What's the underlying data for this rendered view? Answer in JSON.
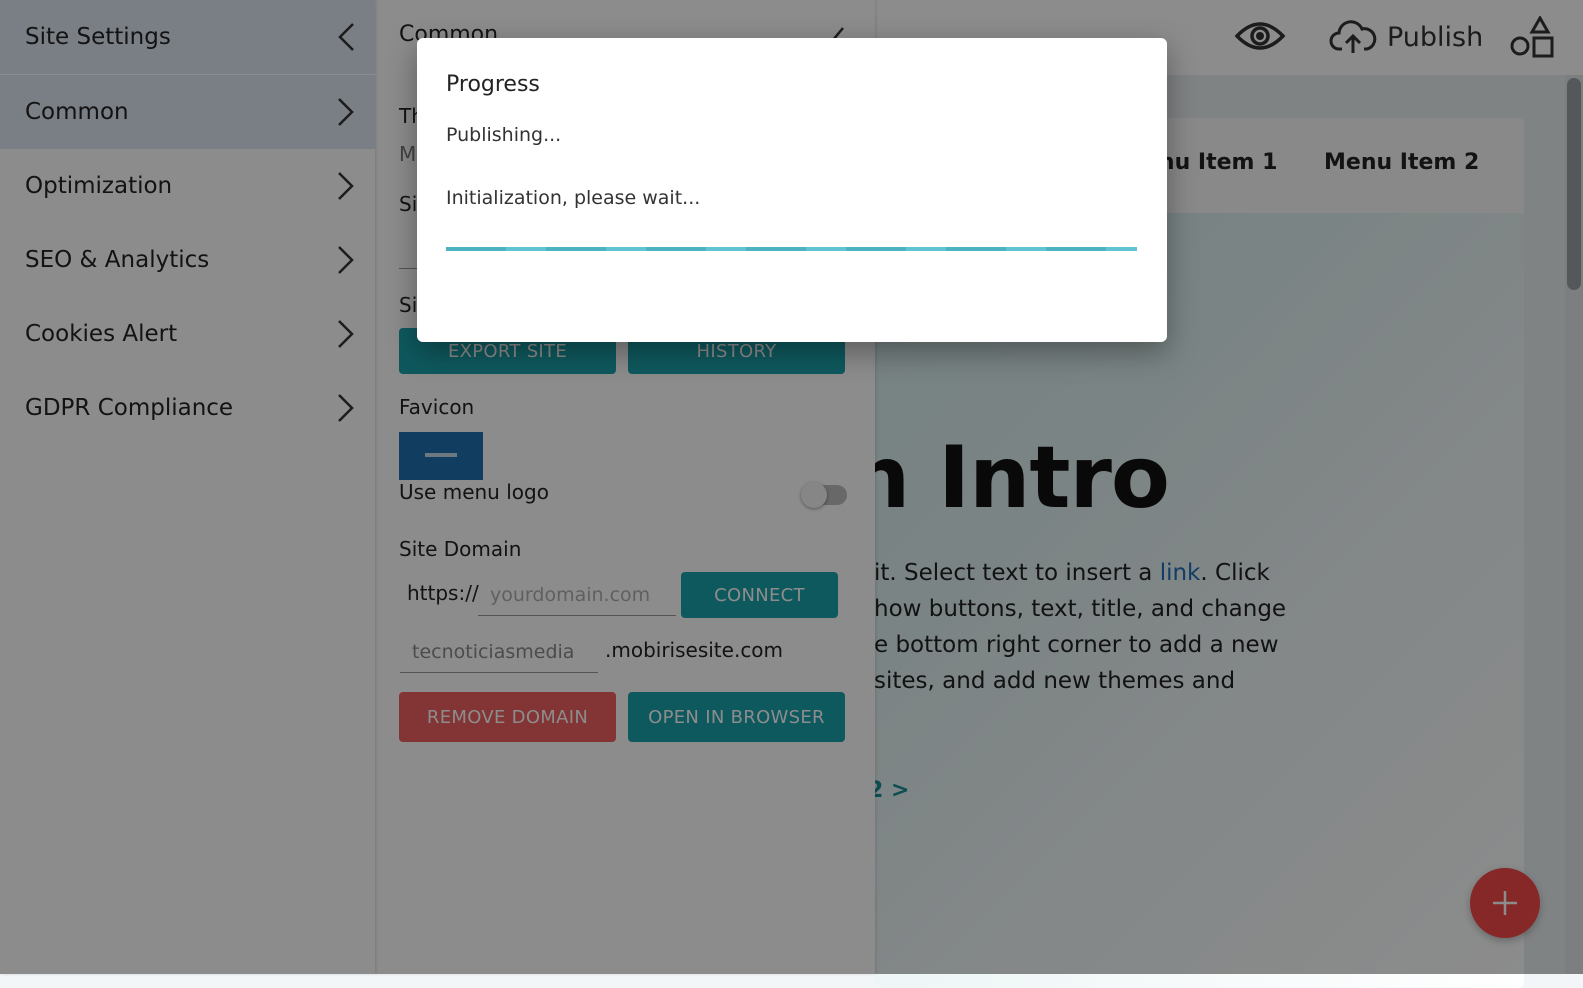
{
  "sidebar": {
    "header": "Site Settings",
    "items": [
      {
        "label": "Common",
        "active": true
      },
      {
        "label": "Optimization"
      },
      {
        "label": "SEO & Analytics"
      },
      {
        "label": "Cookies Alert"
      },
      {
        "label": "GDPR Compliance"
      }
    ]
  },
  "panel": {
    "title": "Common",
    "theme_label_partial": "Th",
    "theme_value_partial": "M",
    "site_label_partial_1": "Si",
    "site_label_partial_2": "Si",
    "export_button": "EXPORT SITE",
    "history_button": "HISTORY",
    "favicon_label": "Favicon",
    "use_menu_logo_label": "Use menu logo",
    "use_menu_logo_on": false,
    "site_domain_label": "Site Domain",
    "protocol_prefix": "https://",
    "domain_placeholder": "yourdomain.com",
    "connect_button": "CONNECT",
    "subdomain_value": "tecnoticiasmedia",
    "subdomain_suffix": ".mobirisesite.com",
    "remove_domain_button": "REMOVE DOMAIN",
    "open_in_browser_button": "OPEN IN BROWSER"
  },
  "topbar": {
    "publish_label": "Publish"
  },
  "preview": {
    "menu_item_1": "enu Item 1",
    "menu_item_2": "Menu Item 2",
    "hero_title": "n Intro",
    "hero_lines": [
      "it. Select text to insert a ",
      "how buttons, text, title, and change",
      "e bottom right corner to add a new",
      "sites, and add new themes and"
    ],
    "hero_link": "link",
    "hero_after_link": ". Click",
    "hero_next": "2 >"
  },
  "dialog": {
    "title": "Progress",
    "status": "Publishing...",
    "message": "Initialization, please wait...",
    "progress": 1.0
  },
  "colors": {
    "accent_teal": "#1aa2ab",
    "danger_red": "#ee5f62",
    "fab_red": "#f44a4a",
    "link_blue": "#1e6fb8",
    "progress": "#4fbfcf"
  },
  "icons": {
    "preview": "eye-icon",
    "publish": "cloud-upload-icon",
    "blocks": "shapes-icon",
    "back": "chevron-left-icon",
    "forward": "chevron-right-icon",
    "add": "plus-icon"
  }
}
